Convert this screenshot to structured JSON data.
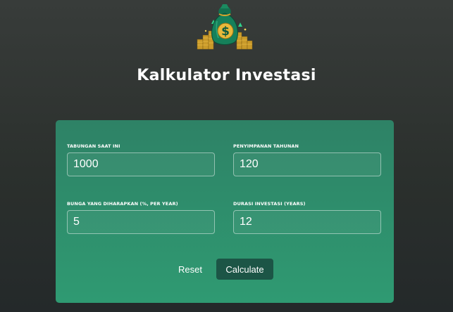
{
  "app": {
    "logo_icon": "money-bag-dollar-icon",
    "title": "Kalkulator Investasi"
  },
  "colors": {
    "background": "#2e3330",
    "card": "#2f8f6c",
    "button_primary": "#1c5546",
    "text": "#ffffff"
  },
  "form": {
    "fields": [
      {
        "label": "TABUNGAN SAAT INI",
        "value": "1000"
      },
      {
        "label": "PENYIMPANAN TAHUNAN",
        "value": "120"
      },
      {
        "label": "BUNGA YANG DIHARAPKAN (%, PER YEAR)",
        "value": "5"
      },
      {
        "label": "DURASI INVESTASI (YEARS)",
        "value": "12"
      }
    ],
    "reset_label": "Reset",
    "calculate_label": "Calculate"
  }
}
